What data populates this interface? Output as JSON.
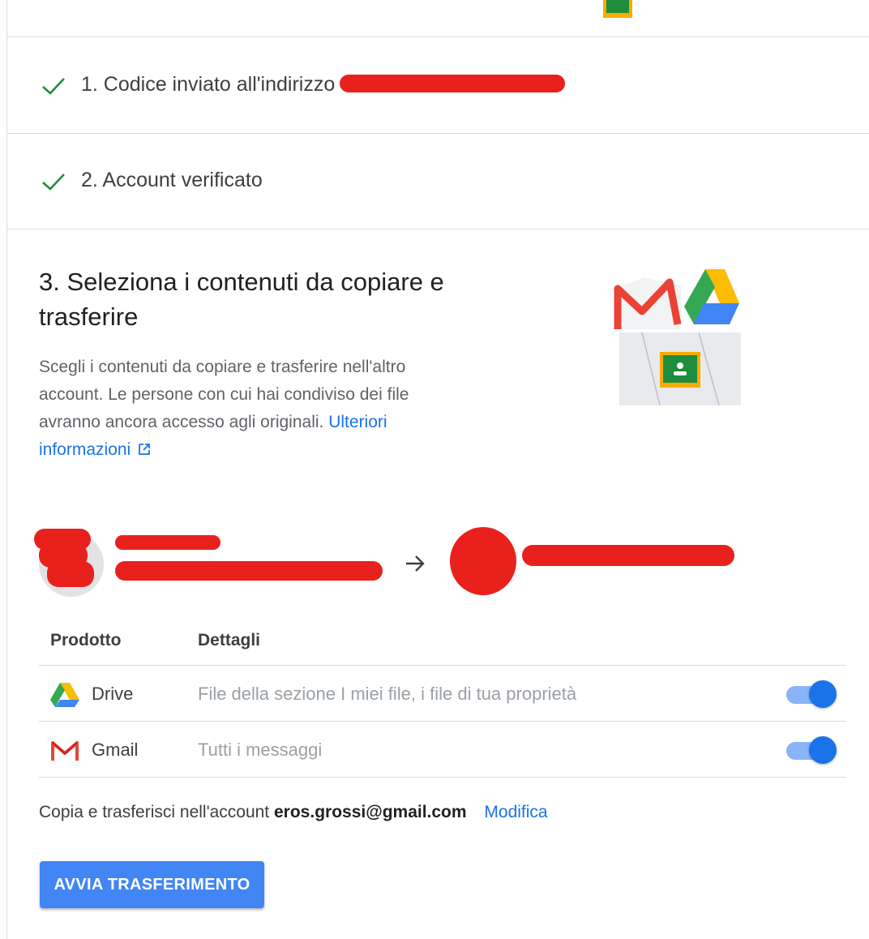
{
  "steps": [
    {
      "label": "1. Codice inviato all'indirizzo",
      "icon": "check-icon"
    },
    {
      "label": "2. Account verificato",
      "icon": "check-icon"
    }
  ],
  "section": {
    "title": "3. Seleziona i contenuti da copiare e trasferire",
    "description": "Scegli i contenuti da copiare e trasferire nell'altro account. Le persone con cui hai condiviso dei file avranno ancora accesso agli originali.",
    "learn_more": "Ulteriori informazioni"
  },
  "table": {
    "headers": {
      "product": "Prodotto",
      "details": "Dettagli"
    },
    "rows": [
      {
        "product": "Drive",
        "details": "File della sezione I miei file, i file di tua proprietà",
        "enabled": true
      },
      {
        "product": "Gmail",
        "details": "Tutti i messaggi",
        "enabled": true
      }
    ]
  },
  "destination": {
    "prefix": "Copia e trasferisci nell'account",
    "email": "eros.grossi@gmail.com",
    "edit_label": "Modifica"
  },
  "start_button": "AVVIA TRASFERIMENTO",
  "colors": {
    "accent": "#1a73e8",
    "button": "#4285f4",
    "check": "#1e8e3e",
    "redaction": "#e8211d"
  }
}
